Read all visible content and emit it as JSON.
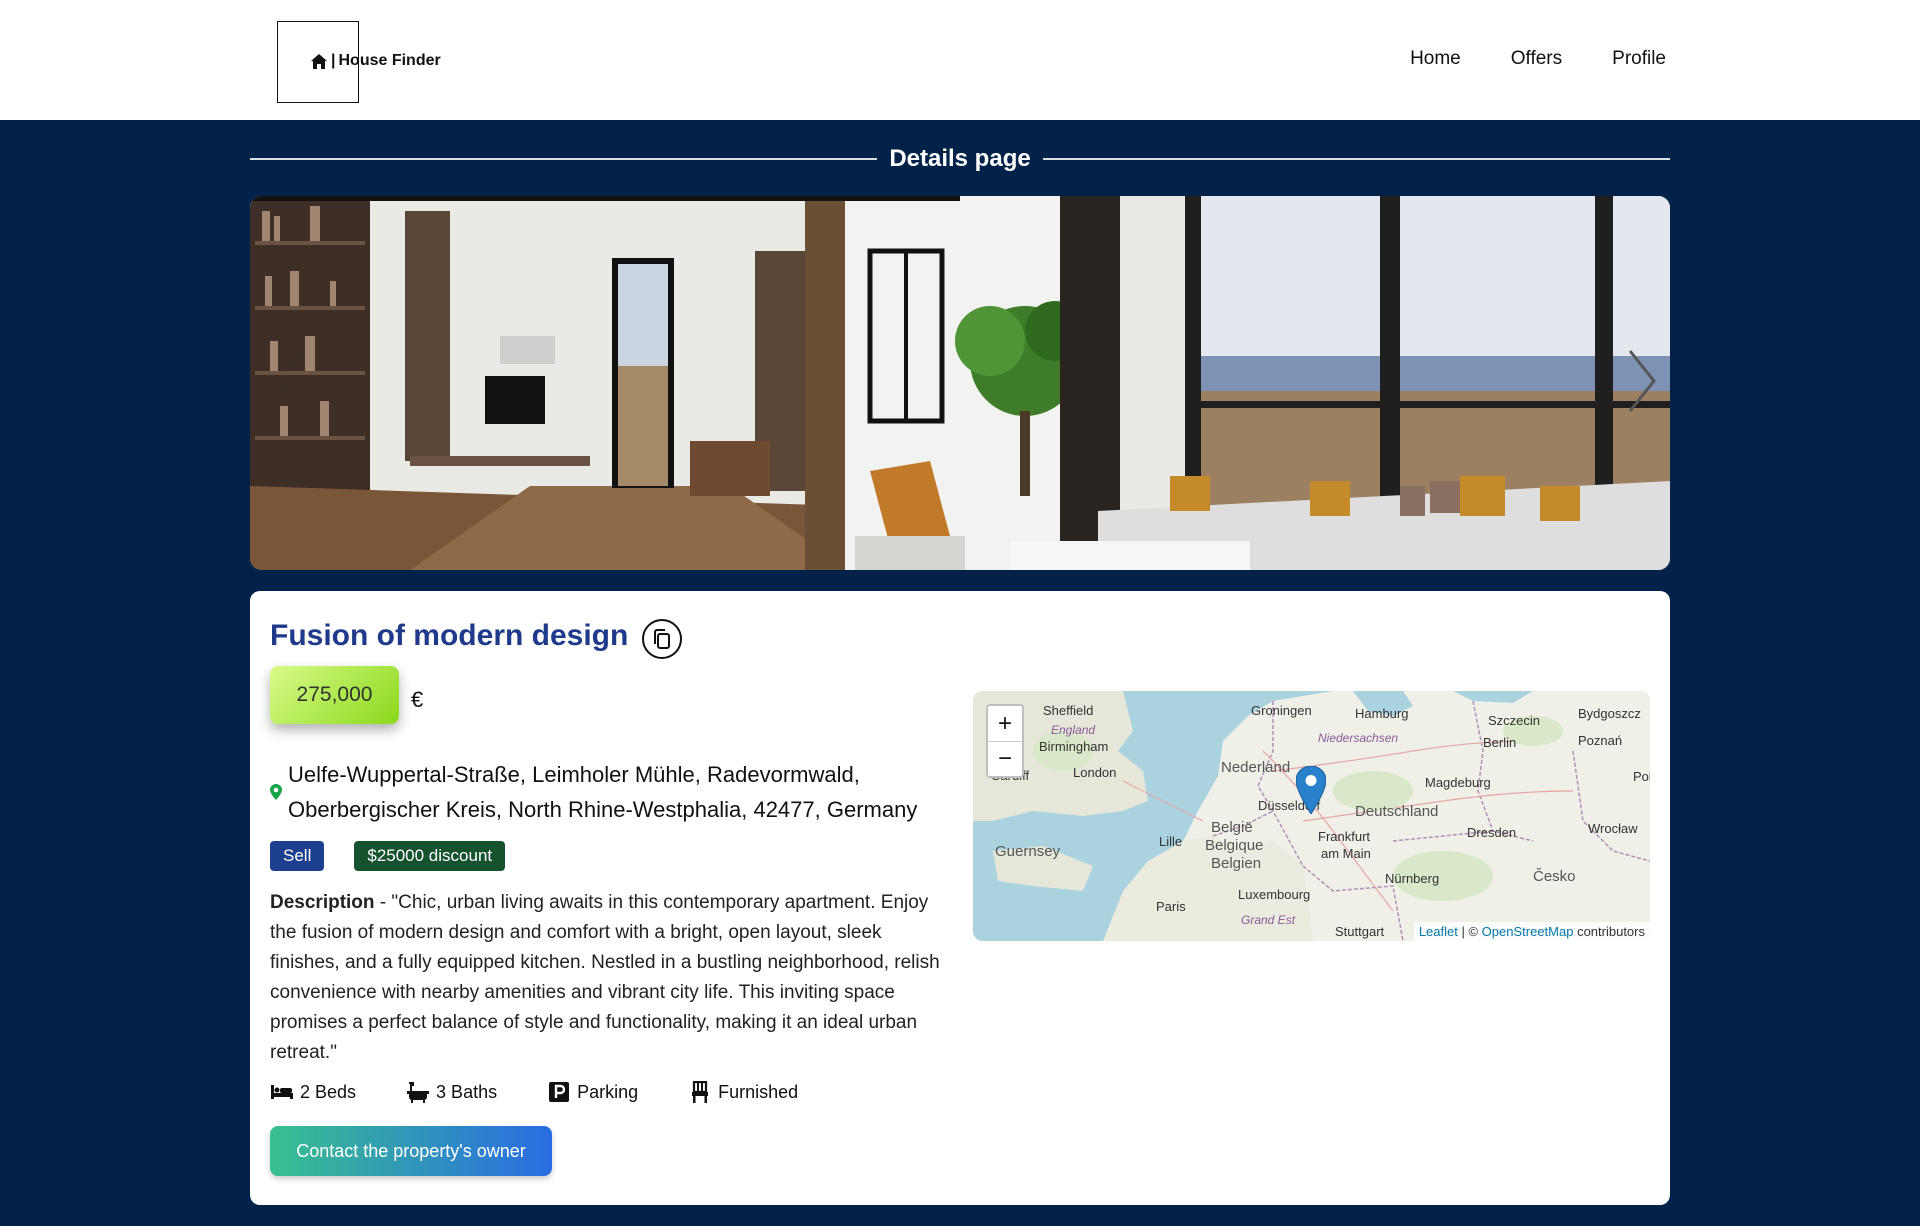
{
  "header": {
    "logo_text": "House Finder",
    "nav": [
      {
        "label": "Home"
      },
      {
        "label": "Offers"
      },
      {
        "label": "Profile"
      }
    ]
  },
  "page": {
    "section_title": "Details page"
  },
  "carousel": {
    "next_icon": "chevron-right-icon",
    "prev_icon": "chevron-left-icon"
  },
  "listing": {
    "title": "Fusion of modern design",
    "price": "275,000",
    "currency": "€",
    "address_line1": "Uelfe-Wuppertal-Straße, Leimholer Mühle, Radevormwald,",
    "address_line2": "Oberbergischer Kreis, North Rhine-Westphalia, 42477, Germany",
    "badges": {
      "type": "Sell",
      "discount": "$25000 discount"
    },
    "description_label": "Description",
    "description_text": " - \"Chic, urban living awaits in this contemporary apartment. Enjoy the fusion of modern design and comfort with a bright, open layout, sleek finishes, and a fully equipped kitchen. Nestled in a bustling neighborhood, relish convenience with nearby amenities and vibrant city life. This inviting space promises a perfect balance of style and functionality, making it an ideal urban retreat.\"",
    "features": [
      {
        "icon": "bed-icon",
        "label": "2 Beds"
      },
      {
        "icon": "bath-icon",
        "label": "3 Baths"
      },
      {
        "icon": "parking-icon",
        "label": "Parking"
      },
      {
        "icon": "chair-icon",
        "label": "Furnished"
      }
    ],
    "contact_button": "Contact the property's owner"
  },
  "map": {
    "zoom_in": "+",
    "zoom_out": "−",
    "attribution_leaflet": "Leaflet",
    "attribution_sep": " | © ",
    "attribution_osm": "OpenStreetMap",
    "attribution_tail": " contributors",
    "labels": {
      "sheffield": "Sheffield",
      "england": "England",
      "birmingham": "Birmingham",
      "london": "London",
      "cardiff": "Cardiff",
      "guernsey": "Guernsey",
      "groningen": "Groningen",
      "hamburg": "Hamburg",
      "szczecin": "Szczecin",
      "bydgoszcz": "Bydgoszcz",
      "niedersachsen": "Niedersachsen",
      "berlin": "Berlin",
      "poznan": "Poznań",
      "nederland": "Nederland",
      "magdeburg": "Magdeburg",
      "pol": "Pol",
      "dusseldorf": "Düsseldorf",
      "deutschland": "Deutschland",
      "belgie": "België",
      "belgique": "Belgique",
      "belgien": "Belgien",
      "lille": "Lille",
      "frankfurt": "Frankfurt",
      "am_main": "am Main",
      "dresden": "Dresden",
      "wroclaw": "Wrocław",
      "cesko": "Česko",
      "nurnberg": "Nürnberg",
      "luxembourg": "Luxembourg",
      "paris": "Paris",
      "grand_est": "Grand Est",
      "stuttgart": "Stuttgart"
    }
  }
}
